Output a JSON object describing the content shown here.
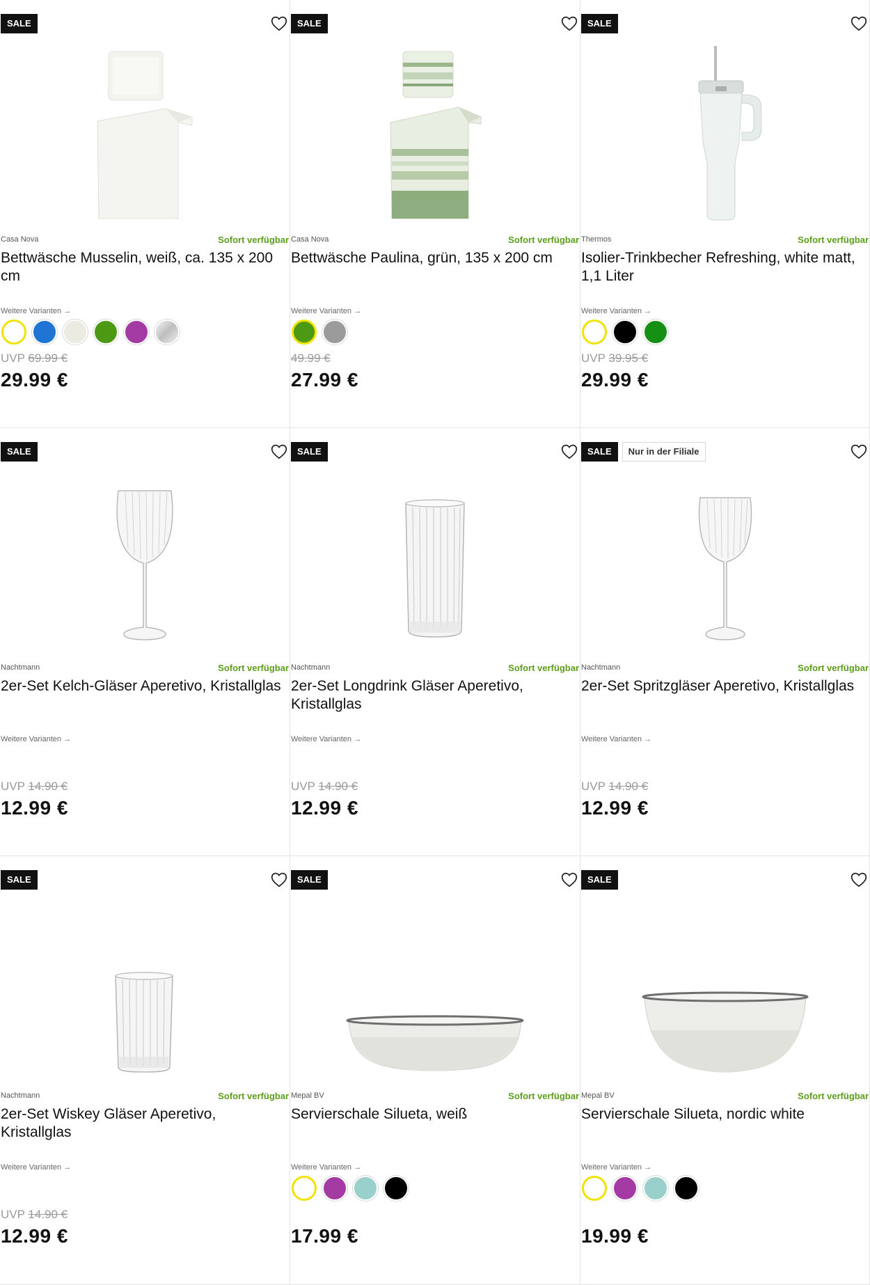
{
  "labels": {
    "sale": "SALE",
    "availability": "Sofort verfügbar",
    "variants": "Weitere Varianten →",
    "uvp_prefix": "UVP"
  },
  "products": [
    {
      "brand": "Casa Nova",
      "title": "Bettwäsche Musselin, weiß, ca. 135 x 200 cm",
      "image": "white-bedding-image",
      "swatches": [
        {
          "color": "#ffffff",
          "selected": true
        },
        {
          "color": "#1f74d4",
          "selected": false
        },
        {
          "color": "#ecebe1",
          "selected": false
        },
        {
          "color": "#4c9a14",
          "selected": false
        },
        {
          "color": "#a43aa4",
          "selected": false
        },
        {
          "color": "#cfcfcf",
          "selected": false
        }
      ],
      "uvp": "UVP",
      "old_price": "69.99 €",
      "price": "29.99 €"
    },
    {
      "brand": "Casa Nova",
      "title": "Bettwäsche Paulina, grün, 135 x 200 cm",
      "image": "green-striped-bedding-image",
      "swatches": [
        {
          "color": "#4c9a14",
          "selected": true
        },
        {
          "color": "#9b9b9b",
          "selected": false
        }
      ],
      "uvp": "",
      "old_price": "49.99 €",
      "price": "27.99 €"
    },
    {
      "brand": "Thermos",
      "title": "Isolier-Trinkbecher Refreshing, white matt, 1,1 Liter",
      "image": "insulated-tumbler-image",
      "swatches": [
        {
          "color": "#ffffff",
          "selected": true
        },
        {
          "color": "#000000",
          "selected": false
        },
        {
          "color": "#159015",
          "selected": false
        }
      ],
      "uvp": "UVP",
      "old_price": "39.95 €",
      "price": "29.99 €"
    },
    {
      "brand": "Nachtmann",
      "title": "2er-Set Kelch-Gläser Aperetivo, Kristallglas",
      "image": "wine-glass-image",
      "swatches": [],
      "uvp": "UVP",
      "old_price": "14.90 €",
      "price": "12.99 €"
    },
    {
      "brand": "Nachtmann",
      "title": "2er-Set Longdrink Gläser Aperetivo, Kristallglas",
      "image": "longdrink-glass-image",
      "swatches": [],
      "uvp": "UVP",
      "old_price": "14.90 €",
      "price": "12.99 €"
    },
    {
      "brand": "Nachtmann",
      "title": "2er-Set Spritzgläser Aperetivo, Kristallglas",
      "image": "spritz-glass-image",
      "store_badge": "Nur in der Filiale",
      "swatches": [],
      "uvp": "UVP",
      "old_price": "14.90 €",
      "price": "12.99 €"
    },
    {
      "brand": "Nachtmann",
      "title": "2er-Set Wiskey Gläser Aperetivo, Kristallglas",
      "image": "whiskey-glass-image",
      "swatches": [],
      "uvp": "UVP",
      "old_price": "14.90 €",
      "price": "12.99 €"
    },
    {
      "brand": "Mepal BV",
      "title": "Servierschale Silueta, weiß",
      "image": "serving-bowl-shallow-image",
      "swatches": [
        {
          "color": "#ffffff",
          "selected": true
        },
        {
          "color": "#a43aa4",
          "selected": false
        },
        {
          "color": "#9ad0cb",
          "selected": false
        },
        {
          "color": "#000000",
          "selected": false
        }
      ],
      "uvp": "",
      "old_price": "",
      "price": "17.99 €"
    },
    {
      "brand": "Mepal BV",
      "title": "Servierschale Silueta, nordic white",
      "image": "serving-bowl-deep-image",
      "swatches": [
        {
          "color": "#ffffff",
          "selected": true
        },
        {
          "color": "#a43aa4",
          "selected": false
        },
        {
          "color": "#9ad0cb",
          "selected": false
        },
        {
          "color": "#000000",
          "selected": false
        }
      ],
      "uvp": "",
      "old_price": "",
      "price": "19.99 €"
    }
  ]
}
